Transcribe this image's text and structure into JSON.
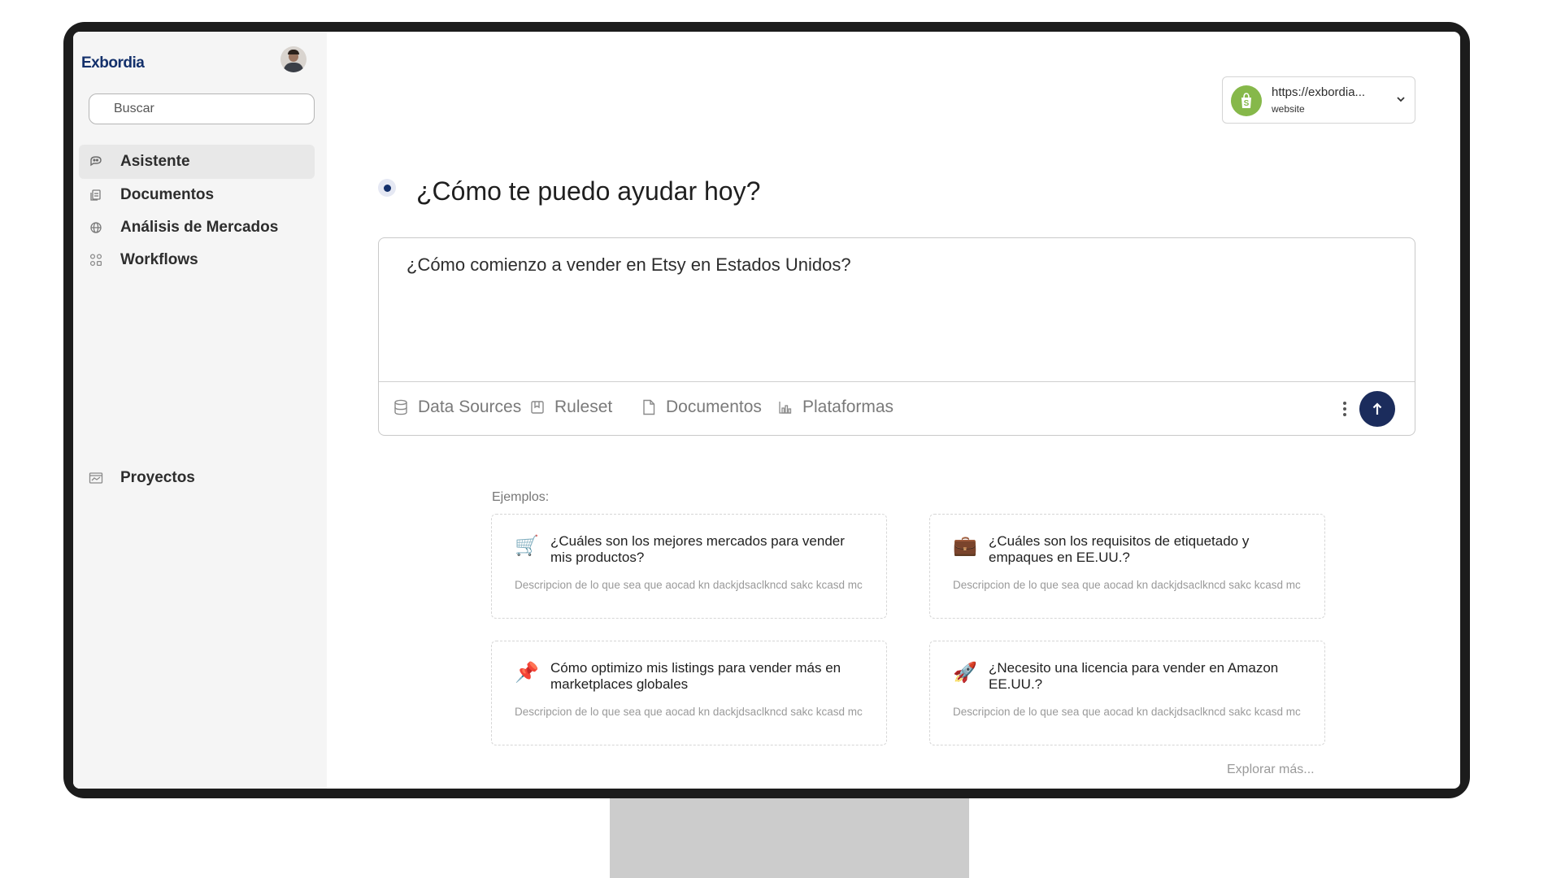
{
  "app": {
    "logo": "Exbordia"
  },
  "sidebar": {
    "search_placeholder": "Buscar",
    "items": [
      {
        "label": "Asistente",
        "icon": "chat-icon",
        "active": true
      },
      {
        "label": "Documentos",
        "icon": "documents-icon",
        "active": false
      },
      {
        "label": "Análisis de Mercados",
        "icon": "globe-icon",
        "active": false
      },
      {
        "label": "Workflows",
        "icon": "workflow-icon",
        "active": false
      }
    ],
    "projects": {
      "label": "Proyectos",
      "icon": "projects-icon"
    }
  },
  "site_selector": {
    "url": "https://exbordia...",
    "type": "website",
    "icon": "shopify-icon"
  },
  "main": {
    "heading": "¿Cómo te puedo ayudar hoy?",
    "prompt": {
      "value": "¿Cómo comienzo a vender en Etsy en Estados Unidos?",
      "tools": [
        {
          "label": "Data Sources",
          "icon": "database-icon"
        },
        {
          "label": "Ruleset",
          "icon": "ruleset-icon"
        },
        {
          "label": "Documentos",
          "icon": "document-icon"
        },
        {
          "label": "Plataformas",
          "icon": "platforms-icon"
        }
      ]
    },
    "examples_label": "Ejemplos:",
    "examples": [
      {
        "emoji": "🛒",
        "title": "¿Cuáles son los mejores mercados para vender mis productos?",
        "description": "Descripcion de lo que sea que aocad kn dackjdsaclkncd sakc kcasd mc"
      },
      {
        "emoji": "💼",
        "title": "¿Cuáles son los requisitos de etiquetado y empaques en EE.UU.?",
        "description": "Descripcion de lo que sea que aocad kn dackjdsaclkncd sakc kcasd mc"
      },
      {
        "emoji": "📌",
        "title": "Cómo optimizo mis listings para vender más en marketplaces globales",
        "description": "Descripcion de lo que sea que aocad kn dackjdsaclkncd sakc kcasd mc"
      },
      {
        "emoji": "🚀",
        "title": "¿Necesito una licencia para vender en Amazon EE.UU.?",
        "description": "Descripcion de lo que sea que aocad kn dackjdsaclkncd sakc kcasd mc"
      }
    ],
    "explore_more": "Explorar más..."
  },
  "colors": {
    "brand": "#13306b",
    "send_button": "#1b2c5c",
    "shop_badge": "#86b84a",
    "sidebar_bg": "#f5f5f5"
  }
}
